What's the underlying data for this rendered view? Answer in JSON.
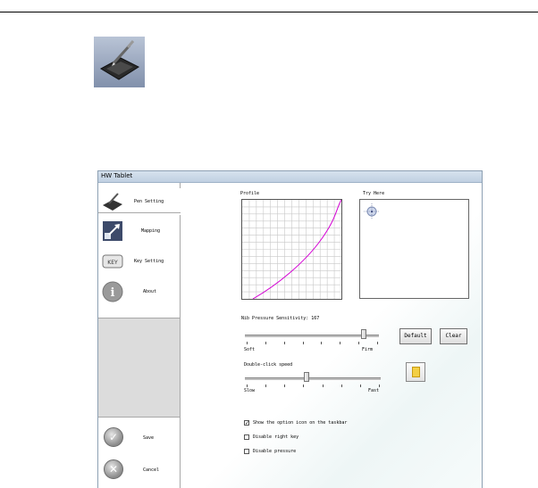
{
  "window": {
    "title": "HW Tablet"
  },
  "sidebar": {
    "items": [
      {
        "label": "Pen Setting",
        "icon": "pen-tablet-icon",
        "selected": true
      },
      {
        "label": "Mapping",
        "icon": "mapping-icon",
        "selected": false
      },
      {
        "label": "Key Setting",
        "icon": "key-icon",
        "selected": false
      },
      {
        "label": "About",
        "icon": "info-icon",
        "selected": false
      }
    ],
    "actions": [
      {
        "label": "Save",
        "icon": "checkmark-icon"
      },
      {
        "label": "Cancel",
        "icon": "close-icon"
      }
    ]
  },
  "profile": {
    "label": "Profile"
  },
  "try_here": {
    "label": "Try Here"
  },
  "pressure": {
    "label": "Nib Pressure Sensitivity: 167",
    "min_label": "Soft",
    "max_label": "Firm",
    "position": 0.9
  },
  "double_click": {
    "label": "Double-click speed",
    "min_label": "Slow",
    "max_label": "Fast",
    "position": 0.45
  },
  "buttons": {
    "default_label": "Default",
    "clear_label": "Clear"
  },
  "options": [
    {
      "label": "Show the option icon on the taskbar",
      "checked": true
    },
    {
      "label": "Disable right key",
      "checked": false
    },
    {
      "label": "Disable pressure",
      "checked": false
    }
  ],
  "colors": {
    "curve": "#d400d4",
    "grid": "#c8c8c8",
    "titlebar": "#c8d6e6"
  }
}
